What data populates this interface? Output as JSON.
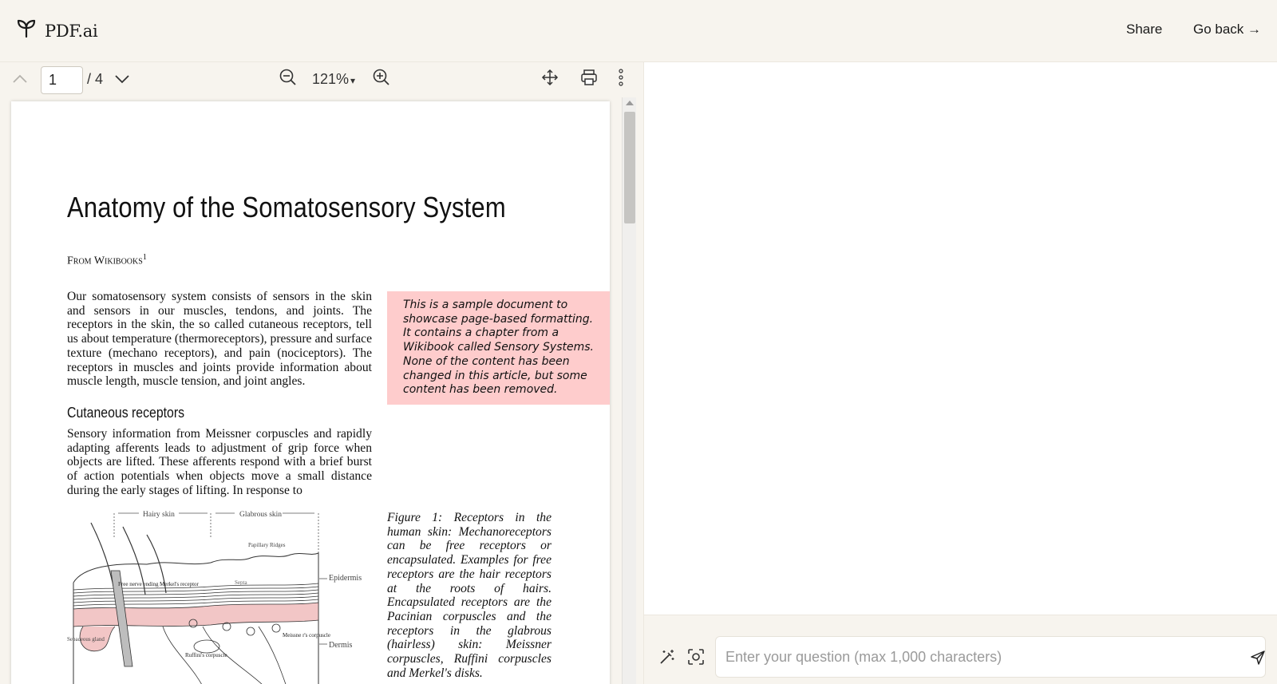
{
  "header": {
    "app_name": "PDF.ai",
    "share_label": "Share",
    "go_back_label": "Go back →"
  },
  "toolbar": {
    "current_page": "1",
    "total_pages": "/ 4",
    "zoom": "121%",
    "zoom_caret": "▾"
  },
  "document": {
    "title": "Anatomy of the Somatosensory System",
    "byline": "From Wikibooks",
    "footnote_mark": "1",
    "paragraph1": "Our somatosensory system consists of sensors in the skin and sensors in our muscles, tendons, and joints. The receptors in the skin, the so called cutaneous receptors, tell us about temperature (thermoreceptors), pressure and surface texture (mechano receptors), and pain (nociceptors). The receptors in muscles and joints provide information about muscle length, muscle tension, and joint angles.",
    "heading": "Cutaneous receptors",
    "paragraph2": "Sensory information from Meissner corpuscles and rapidly adapting afferents leads to adjustment of grip force when objects are lifted. These afferents respond with a brief burst of action potentials when objects move a small distance during the early stages of lifting. In response to",
    "note": "This is a sample document to showcase page-based formatting. It contains a chapter from a Wikibook called Sensory Systems. None of the content has been changed in this article, but some content has been removed.",
    "caption": "Figure 1: Receptors in the human skin: Mechanoreceptors can be free receptors or encapsulated. Examples for free receptors are the hair receptors at the roots of hairs. Encapsulated receptors are the Pacinian corpuscles and the receptors in the glabrous (hairless) skin: Meissner corpuscles, Ruffini corpuscles and Merkel's disks.",
    "figure_labels": {
      "hairy_skin": "Hairy skin",
      "glabrous_skin": "Glabrous skin",
      "papillary_ridges": "Papillary Ridges",
      "septa": "Septa",
      "epidermis": "Epidermis",
      "dermis": "Dermis",
      "free_nerve_ending": "Free nerve ending",
      "merkels_receptor": "Merkel's receptor",
      "sebaceous_gland": "Sebaceous gland",
      "meissners_corpuscle": "Meissne r's corpuscle",
      "ruffinis_corpuscle": "Ruffini's corpuscle"
    }
  },
  "chat": {
    "input_placeholder": "Enter your question (max 1,000 characters)"
  },
  "colors": {
    "background": "#f7f4ee",
    "note_background": "#fecccc",
    "figure_pink": "#f2c6c6"
  }
}
